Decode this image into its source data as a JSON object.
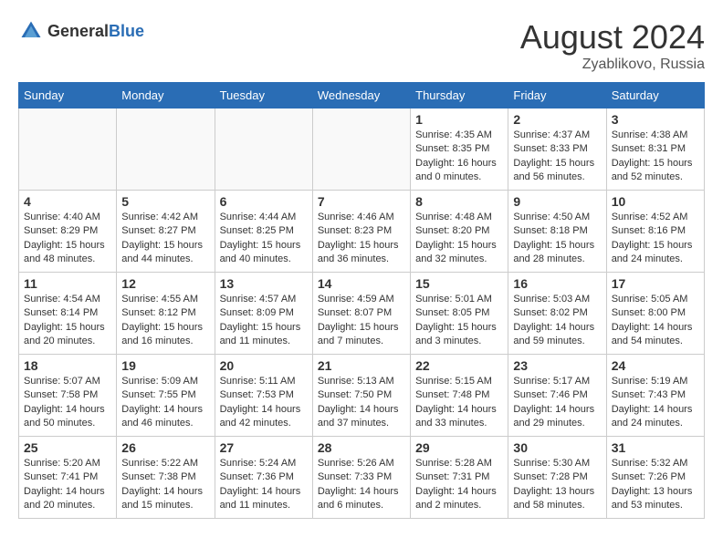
{
  "header": {
    "logo_general": "General",
    "logo_blue": "Blue",
    "month_year": "August 2024",
    "location": "Zyablikovo, Russia"
  },
  "days_of_week": [
    "Sunday",
    "Monday",
    "Tuesday",
    "Wednesday",
    "Thursday",
    "Friday",
    "Saturday"
  ],
  "weeks": [
    [
      {
        "day": "",
        "info": ""
      },
      {
        "day": "",
        "info": ""
      },
      {
        "day": "",
        "info": ""
      },
      {
        "day": "",
        "info": ""
      },
      {
        "day": "1",
        "info": "Sunrise: 4:35 AM\nSunset: 8:35 PM\nDaylight: 16 hours\nand 0 minutes."
      },
      {
        "day": "2",
        "info": "Sunrise: 4:37 AM\nSunset: 8:33 PM\nDaylight: 15 hours\nand 56 minutes."
      },
      {
        "day": "3",
        "info": "Sunrise: 4:38 AM\nSunset: 8:31 PM\nDaylight: 15 hours\nand 52 minutes."
      }
    ],
    [
      {
        "day": "4",
        "info": "Sunrise: 4:40 AM\nSunset: 8:29 PM\nDaylight: 15 hours\nand 48 minutes."
      },
      {
        "day": "5",
        "info": "Sunrise: 4:42 AM\nSunset: 8:27 PM\nDaylight: 15 hours\nand 44 minutes."
      },
      {
        "day": "6",
        "info": "Sunrise: 4:44 AM\nSunset: 8:25 PM\nDaylight: 15 hours\nand 40 minutes."
      },
      {
        "day": "7",
        "info": "Sunrise: 4:46 AM\nSunset: 8:23 PM\nDaylight: 15 hours\nand 36 minutes."
      },
      {
        "day": "8",
        "info": "Sunrise: 4:48 AM\nSunset: 8:20 PM\nDaylight: 15 hours\nand 32 minutes."
      },
      {
        "day": "9",
        "info": "Sunrise: 4:50 AM\nSunset: 8:18 PM\nDaylight: 15 hours\nand 28 minutes."
      },
      {
        "day": "10",
        "info": "Sunrise: 4:52 AM\nSunset: 8:16 PM\nDaylight: 15 hours\nand 24 minutes."
      }
    ],
    [
      {
        "day": "11",
        "info": "Sunrise: 4:54 AM\nSunset: 8:14 PM\nDaylight: 15 hours\nand 20 minutes."
      },
      {
        "day": "12",
        "info": "Sunrise: 4:55 AM\nSunset: 8:12 PM\nDaylight: 15 hours\nand 16 minutes."
      },
      {
        "day": "13",
        "info": "Sunrise: 4:57 AM\nSunset: 8:09 PM\nDaylight: 15 hours\nand 11 minutes."
      },
      {
        "day": "14",
        "info": "Sunrise: 4:59 AM\nSunset: 8:07 PM\nDaylight: 15 hours\nand 7 minutes."
      },
      {
        "day": "15",
        "info": "Sunrise: 5:01 AM\nSunset: 8:05 PM\nDaylight: 15 hours\nand 3 minutes."
      },
      {
        "day": "16",
        "info": "Sunrise: 5:03 AM\nSunset: 8:02 PM\nDaylight: 14 hours\nand 59 minutes."
      },
      {
        "day": "17",
        "info": "Sunrise: 5:05 AM\nSunset: 8:00 PM\nDaylight: 14 hours\nand 54 minutes."
      }
    ],
    [
      {
        "day": "18",
        "info": "Sunrise: 5:07 AM\nSunset: 7:58 PM\nDaylight: 14 hours\nand 50 minutes."
      },
      {
        "day": "19",
        "info": "Sunrise: 5:09 AM\nSunset: 7:55 PM\nDaylight: 14 hours\nand 46 minutes."
      },
      {
        "day": "20",
        "info": "Sunrise: 5:11 AM\nSunset: 7:53 PM\nDaylight: 14 hours\nand 42 minutes."
      },
      {
        "day": "21",
        "info": "Sunrise: 5:13 AM\nSunset: 7:50 PM\nDaylight: 14 hours\nand 37 minutes."
      },
      {
        "day": "22",
        "info": "Sunrise: 5:15 AM\nSunset: 7:48 PM\nDaylight: 14 hours\nand 33 minutes."
      },
      {
        "day": "23",
        "info": "Sunrise: 5:17 AM\nSunset: 7:46 PM\nDaylight: 14 hours\nand 29 minutes."
      },
      {
        "day": "24",
        "info": "Sunrise: 5:19 AM\nSunset: 7:43 PM\nDaylight: 14 hours\nand 24 minutes."
      }
    ],
    [
      {
        "day": "25",
        "info": "Sunrise: 5:20 AM\nSunset: 7:41 PM\nDaylight: 14 hours\nand 20 minutes."
      },
      {
        "day": "26",
        "info": "Sunrise: 5:22 AM\nSunset: 7:38 PM\nDaylight: 14 hours\nand 15 minutes."
      },
      {
        "day": "27",
        "info": "Sunrise: 5:24 AM\nSunset: 7:36 PM\nDaylight: 14 hours\nand 11 minutes."
      },
      {
        "day": "28",
        "info": "Sunrise: 5:26 AM\nSunset: 7:33 PM\nDaylight: 14 hours\nand 6 minutes."
      },
      {
        "day": "29",
        "info": "Sunrise: 5:28 AM\nSunset: 7:31 PM\nDaylight: 14 hours\nand 2 minutes."
      },
      {
        "day": "30",
        "info": "Sunrise: 5:30 AM\nSunset: 7:28 PM\nDaylight: 13 hours\nand 58 minutes."
      },
      {
        "day": "31",
        "info": "Sunrise: 5:32 AM\nSunset: 7:26 PM\nDaylight: 13 hours\nand 53 minutes."
      }
    ]
  ]
}
